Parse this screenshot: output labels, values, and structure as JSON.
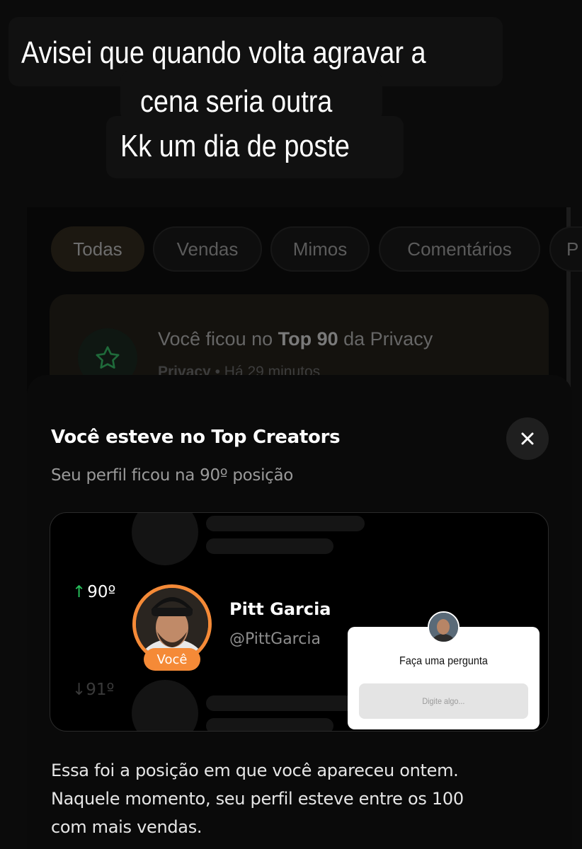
{
  "caption": {
    "lines": [
      "Avisei que quando volta agravar a",
      "cena seria outra",
      "Kk  um dia de poste"
    ]
  },
  "filters": {
    "chips": [
      "Todas",
      "Vendas",
      "Mimos",
      "Comentários",
      "P"
    ],
    "active": "Todas"
  },
  "notification": {
    "icon": "star-icon",
    "text_prefix": "Você ficou no ",
    "text_bold": "Top 90",
    "text_suffix": " da Privacy",
    "source": "Privacy",
    "separator": "•",
    "time": "Há 29 minutos"
  },
  "sheet": {
    "title": "Você esteve no Top Creators",
    "subtitle": "Seu perfil ficou na 90º posição",
    "close_icon": "close-icon",
    "rank_up": "90º",
    "rank_down": "91º",
    "badge": "Você",
    "user_name": "Pitt Garcia",
    "user_handle": "@PittGarcia",
    "body_lines": [
      "Essa foi a posição em que você apareceu ontem.",
      "Naquele momento, seu perfil esteve entre os 100",
      "com mais vendas."
    ]
  },
  "question_sticker": {
    "title": "Faça uma pergunta",
    "placeholder": "Digite algo..."
  },
  "colors": {
    "accent_orange": "#f58a37",
    "up_green": "#27c05c",
    "background": "#0b0b0b"
  }
}
